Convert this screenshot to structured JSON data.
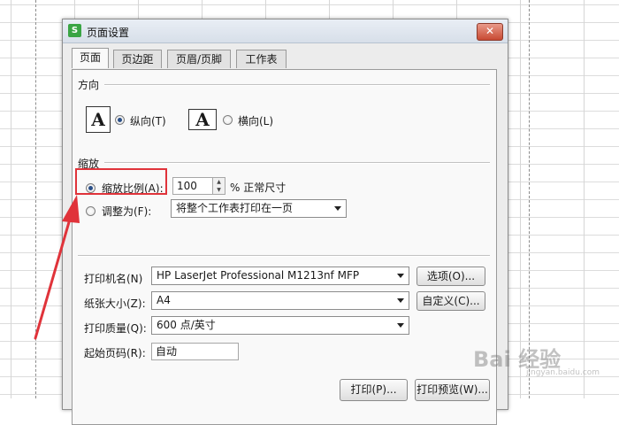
{
  "dialog": {
    "title": "页面设置",
    "app_icon_letter": "S",
    "close_glyph": "✕",
    "tabs": [
      {
        "label": "页面",
        "active": true
      },
      {
        "label": "页边距",
        "active": false
      },
      {
        "label": "页眉/页脚",
        "active": false
      },
      {
        "label": "工作表",
        "active": false
      }
    ]
  },
  "orientation": {
    "section_label": "方向",
    "icon_glyph": "A",
    "portrait_label": "纵向(T)",
    "landscape_label": "横向(L)",
    "selected": "portrait"
  },
  "scaling": {
    "section_label": "缩放",
    "scale_label": "缩放比例(A):",
    "scale_value": "100",
    "scale_suffix": "% 正常尺寸",
    "fit_label": "调整为(F):",
    "fit_value": "将整个工作表打印在一页",
    "selected": "scale"
  },
  "printer": {
    "printer_label": "打印机名(N)",
    "printer_value": "HP LaserJet Professional M1213nf MFP",
    "options_button": "选项(O)...",
    "paper_label": "纸张大小(Z):",
    "paper_value": "A4",
    "custom_button": "自定义(C)...",
    "quality_label": "打印质量(Q):",
    "quality_value": "600 点/英寸",
    "start_page_label": "起始页码(R):",
    "start_page_value": "自动"
  },
  "footer": {
    "print_button": "打印(P)...",
    "preview_button": "打印预览(W)..."
  },
  "annotation": {
    "color": "#e0333a"
  },
  "watermark": {
    "main": "Bai 经验",
    "sub": "jingyan.baidu.com"
  }
}
